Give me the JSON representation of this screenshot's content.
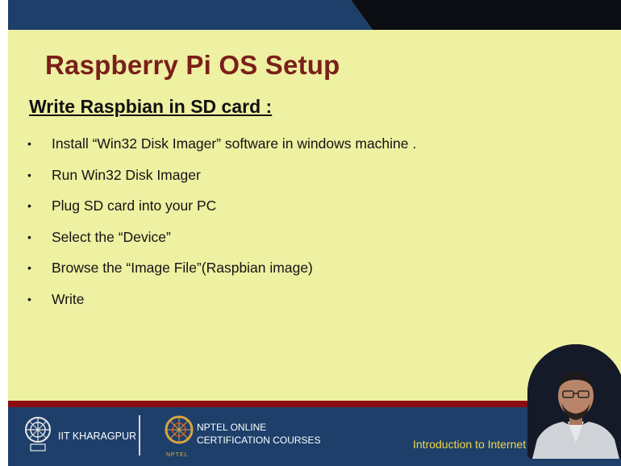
{
  "slide": {
    "title": "Raspberry Pi OS Setup",
    "subtitle": "Write Raspbian in SD card :",
    "bullet_symbol": "•",
    "bullets": [
      "Install “Win32 Disk Imager” software in windows machine .",
      "Run Win32 Disk Imager",
      "Plug SD card into your PC",
      "Select the “Device”",
      "Browse the “Image File”(Raspbian image)",
      "Write"
    ]
  },
  "footer": {
    "institute": "IIT KHARAGPUR",
    "nptel_line1": "NPTEL ONLINE",
    "nptel_line2": "CERTIFICATION COURSES",
    "nptel_small": "NPTEL",
    "course": "Introduction to Internet of"
  },
  "colors": {
    "slide_background": "#eef0a2",
    "title": "#7a1f1a",
    "top_band": "#1d3f6a",
    "footer": "#1d3f6a",
    "footer_stripe": "#8b0b12",
    "course_text": "#f2d64b"
  }
}
